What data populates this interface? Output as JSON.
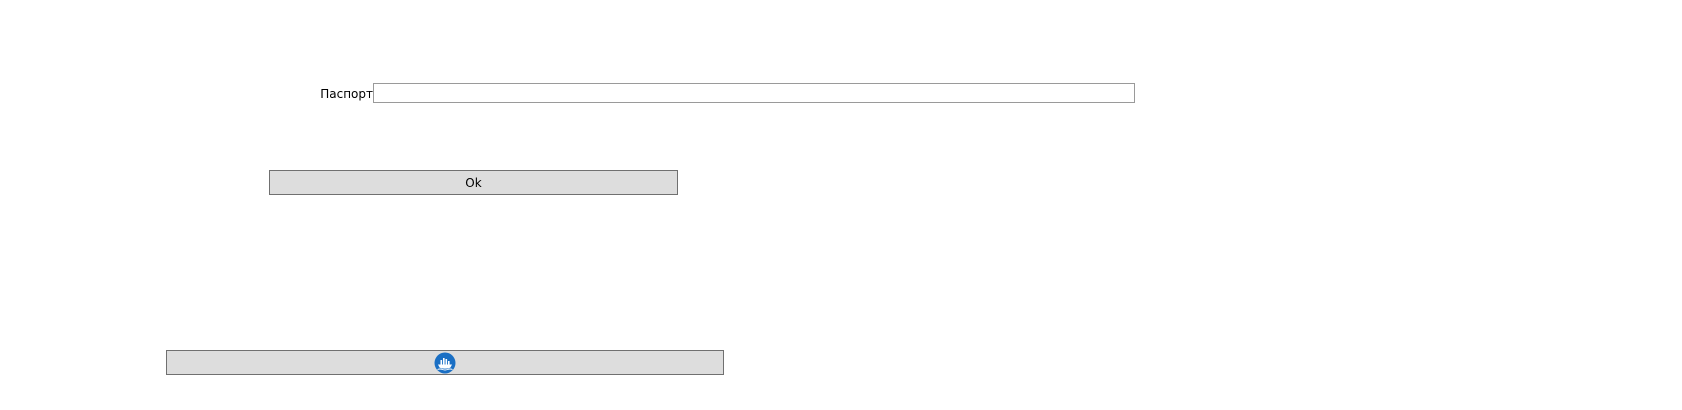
{
  "form": {
    "passport_label": "Паспорт",
    "passport_value": "",
    "ok_label": "Ok"
  },
  "icon_button": {
    "icon": "ship-logo-icon",
    "icon_color": "#1a6fc4"
  }
}
